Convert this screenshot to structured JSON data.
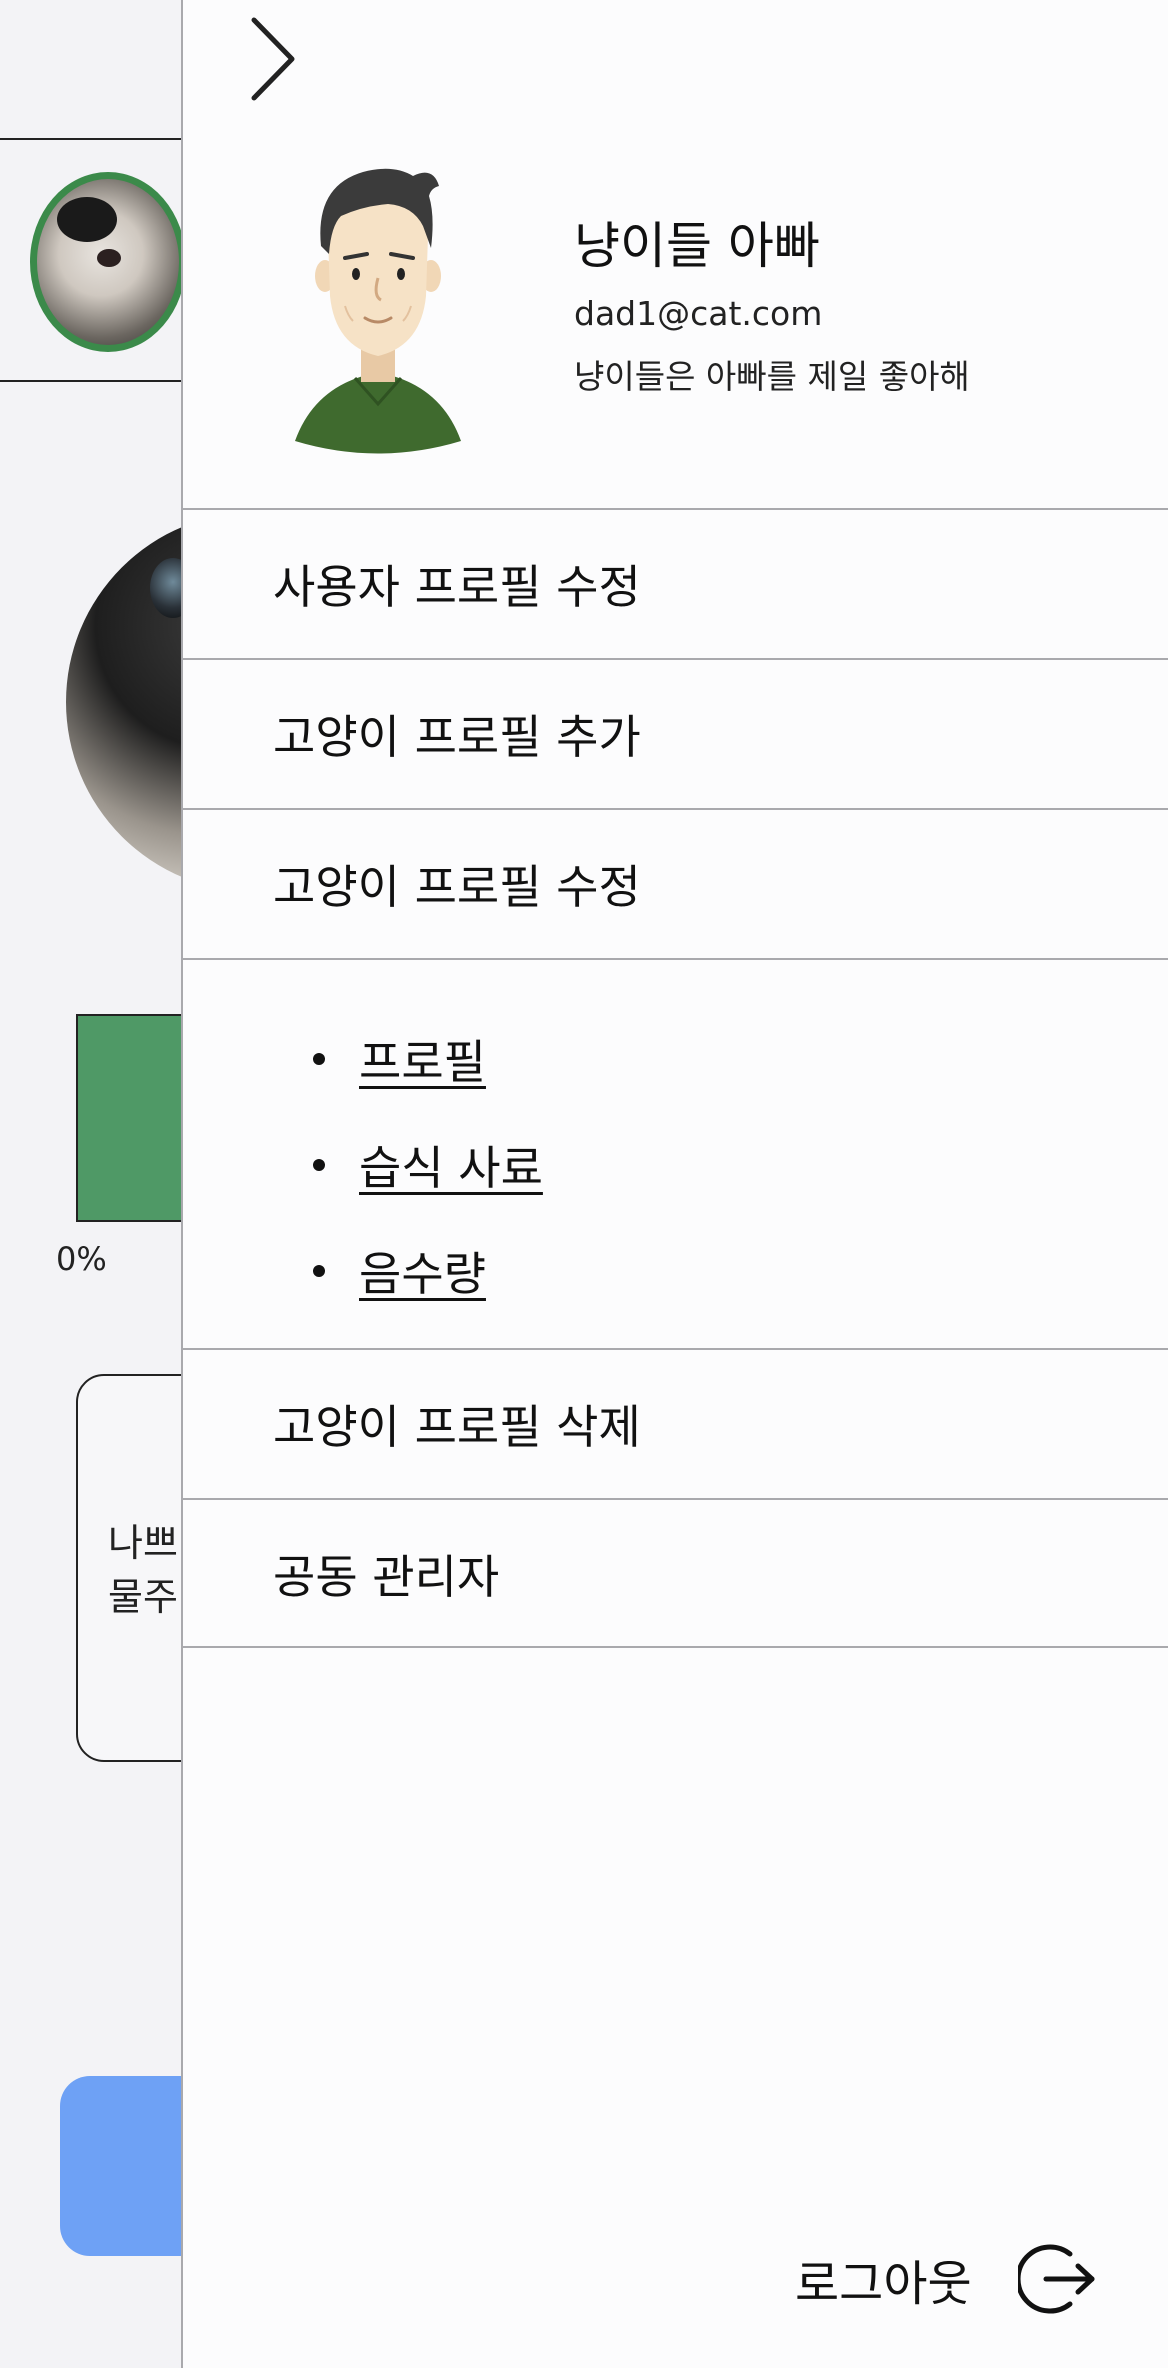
{
  "background": {
    "progress_label": "0%",
    "card_text_line1": "나쁘",
    "card_text_line2": "물주"
  },
  "drawer": {
    "close_icon": "chevron-right-icon",
    "profile": {
      "name": "냥이들 아빠",
      "email": "dad1@cat.com",
      "bio": "냥이들은 아빠를 제일 좋아해"
    },
    "menu": {
      "edit_user_profile": "사용자 프로필 수정",
      "add_cat_profile": "고양이 프로필 추가",
      "edit_cat_profile": "고양이 프로필 수정",
      "sub_items": [
        "프로필",
        "습식 사료",
        "음수량"
      ],
      "delete_cat_profile": "고양이 프로필 삭제",
      "co_managers": "공동 관리자"
    },
    "logout": {
      "label": "로그아웃",
      "icon": "logout-icon"
    }
  },
  "colors": {
    "accent_green": "#4f9966",
    "accent_blue": "#6ea1f5",
    "divider": "#a9a9ad"
  }
}
